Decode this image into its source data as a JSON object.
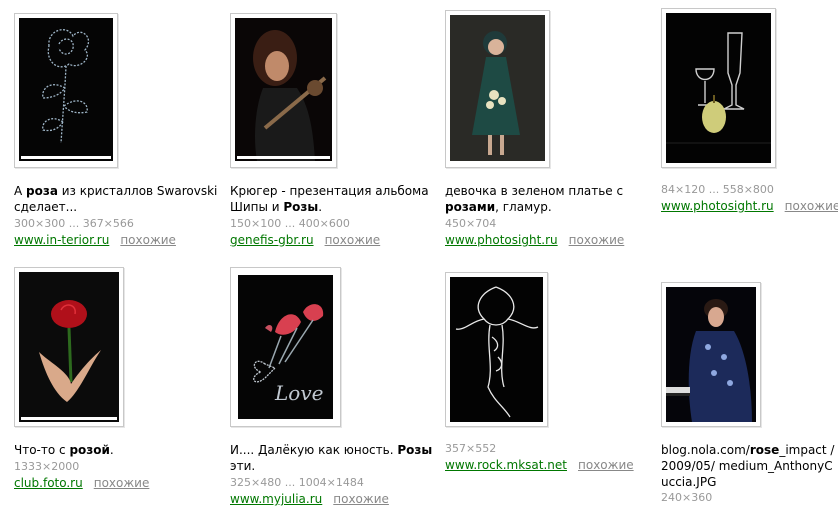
{
  "results": [
    {
      "caption_parts": [
        {
          "t": "А "
        },
        {
          "t": "роза",
          "b": true
        },
        {
          "t": " из кристаллов Swarovski сделает..."
        }
      ],
      "size": "300×300 ... 367×566",
      "source": "www.in-terior.ru",
      "similar": "похожие"
    },
    {
      "caption_parts": [
        {
          "t": "Крюгер - презентация альбома Шипы и "
        },
        {
          "t": "Розы",
          "b": true
        },
        {
          "t": "."
        }
      ],
      "size": "150×100 ... 400×600",
      "source": "genefis-gbr.ru",
      "similar": "похожие"
    },
    {
      "caption_parts": [
        {
          "t": "девочка в зеленом платье с "
        },
        {
          "t": "розами",
          "b": true
        },
        {
          "t": ", гламур."
        }
      ],
      "size": "450×704",
      "source": "www.photosight.ru",
      "similar": "похожие"
    },
    {
      "caption_parts": [],
      "size": "84×120 ... 558×800",
      "source": "www.photosight.ru",
      "similar": "похожие"
    },
    {
      "caption_parts": [
        {
          "t": "Что-то с "
        },
        {
          "t": "розой",
          "b": true
        },
        {
          "t": "."
        }
      ],
      "size": "1333×2000",
      "source": "club.foto.ru",
      "similar": "похожие"
    },
    {
      "caption_parts": [
        {
          "t": "И.... Далёкую как юность. "
        },
        {
          "t": "Розы",
          "b": true
        },
        {
          "t": " эти."
        }
      ],
      "size": "325×480 ... 1004×1484",
      "source": "www.myjulia.ru",
      "similar": "похожие"
    },
    {
      "caption_parts": [],
      "size": "357×552",
      "source": "www.rock.mksat.net",
      "similar": "похожие"
    },
    {
      "caption_parts": [
        {
          "t": "blog.nola.com/"
        },
        {
          "t": "rose",
          "b": true
        },
        {
          "t": "_impact /2009/05/ medium_AnthonyCuccia.JPG"
        }
      ],
      "size": "240×360",
      "source": "",
      "similar": ""
    }
  ],
  "image_texts": {
    "love": "Love"
  }
}
